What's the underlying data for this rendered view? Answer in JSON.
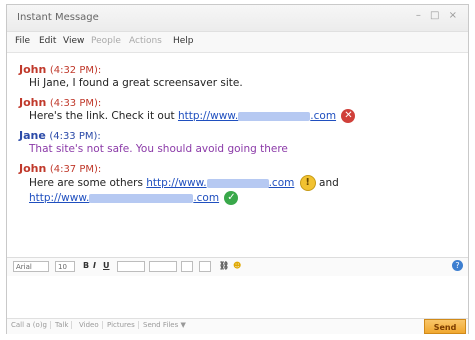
{
  "window": {
    "title": "Instant Message",
    "controls": "– □ ×"
  },
  "menu": {
    "file": "File",
    "edit": "Edit",
    "view": "View",
    "people": "People",
    "actions": "Actions",
    "help": "Help"
  },
  "messages": [
    {
      "sender": "John",
      "time": "(4:32 PM):",
      "text": "Hi Jane, I found a great screensaver site."
    },
    {
      "sender": "John",
      "time": "(4:33 PM):",
      "text": "Here's the link. Check it out",
      "link_prefix": "http://www.",
      "link_suffix": ".com",
      "link_status": "danger",
      "status_glyph": "✕"
    },
    {
      "sender": "Jane",
      "time": "(4:33 PM):",
      "text": "That site's not safe.  You should avoid going there"
    },
    {
      "sender": "John",
      "time": "(4:37 PM):",
      "text": "Here are some others",
      "link_prefix": "http://www.",
      "link_suffix": ".com",
      "link_status": "warning",
      "status_glyph": "!",
      "and_text": "and",
      "link2_prefix": "http://www.",
      "link2_suffix": ".com",
      "link2_status": "safe",
      "status2_glyph": "✓"
    }
  ],
  "format_toolbar": {
    "font_value": "Arial",
    "size_value": "10",
    "bold": "B",
    "italic": "I",
    "underline": "U",
    "help_glyph": "?"
  },
  "bottom_tabs": {
    "call_tab": "Call a (o)g",
    "talk_tab": "Talk",
    "video_tab": "Video",
    "pictures_tab": "Pictures",
    "send_files_tab": "Send Files ▼"
  },
  "send_label": "Send",
  "colors": {
    "john": "#c0392b",
    "jane": "#2b4aa8",
    "jane_text": "#8b3aa8",
    "link": "#1f4fbf",
    "danger": "#d0403a",
    "warning": "#f2c230",
    "safe": "#39a84a",
    "send_button": "#f0a830"
  }
}
